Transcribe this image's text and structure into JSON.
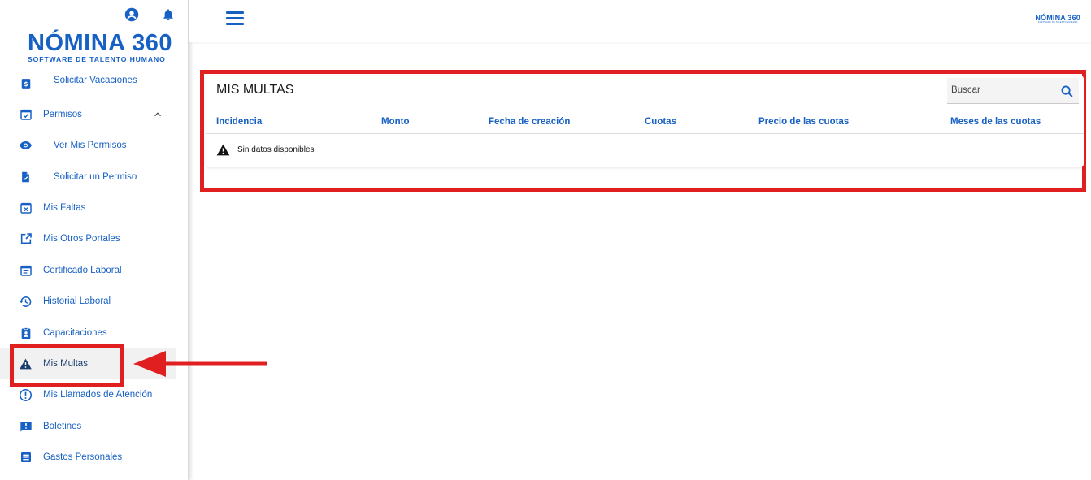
{
  "brand": {
    "name": "NÓMINA 360",
    "tagline": "SOFTWARE DE TALENTO HUMANO"
  },
  "topbar": {
    "logo_name": "NÓMINA 360",
    "logo_tagline": "SOFTWARE DE TALENTO HUMANO"
  },
  "sidebar": {
    "items": [
      {
        "label": "Solicitar Vacaciones",
        "icon": "money-card-icon"
      },
      {
        "label": "Permisos",
        "icon": "calendar-check-icon"
      },
      {
        "label": "Ver Mis Permisos",
        "icon": "eye-icon"
      },
      {
        "label": "Solicitar un Permiso",
        "icon": "file-check-icon"
      },
      {
        "label": "Mis Faltas",
        "icon": "calendar-x-icon"
      },
      {
        "label": "Mis Otros Portales",
        "icon": "external-link-icon"
      },
      {
        "label": "Certificado Laboral",
        "icon": "calendar-lines-icon"
      },
      {
        "label": "Historial Laboral",
        "icon": "history-icon"
      },
      {
        "label": "Capacitaciones",
        "icon": "clipboard-user-icon"
      },
      {
        "label": "Mis Multas",
        "icon": "warning-icon"
      },
      {
        "label": "Mis Llamados de Atención",
        "icon": "alert-circle-icon"
      },
      {
        "label": "Boletines",
        "icon": "message-alert-icon"
      },
      {
        "label": "Gastos Personales",
        "icon": "list-box-icon"
      }
    ]
  },
  "main": {
    "title": "MIS MULTAS",
    "search_placeholder": "Buscar",
    "columns": [
      "Incidencia",
      "Monto",
      "Fecha de creación",
      "Cuotas",
      "Precio de las cuotas",
      "Meses de las cuotas"
    ],
    "empty_text": "Sin datos disponibles"
  },
  "colors": {
    "accent": "#1760c4",
    "highlight": "#e02020"
  }
}
